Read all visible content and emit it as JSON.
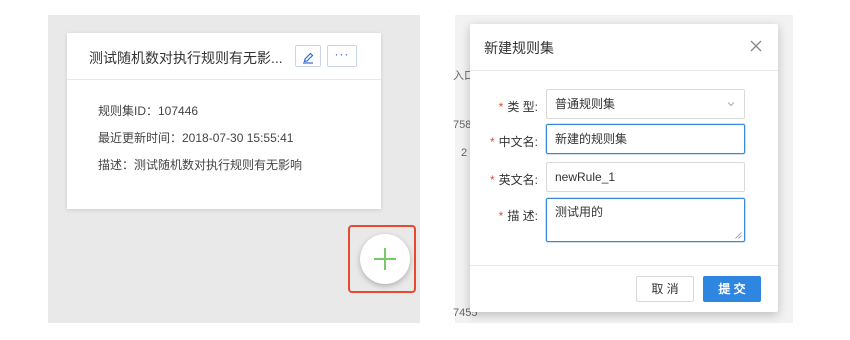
{
  "left": {
    "card": {
      "title": "测试随机数对执行规则有无影...",
      "more_label": "···",
      "fields": [
        {
          "text": "规则集ID：107446"
        },
        {
          "text": "最近更新时间：2018-07-30 15:55:41"
        },
        {
          "text": "描述：测试随机数对执行规则有无影响"
        }
      ]
    },
    "fab_color": "#7bc86c",
    "highlight_color": "#e84a2f"
  },
  "right": {
    "background_fragments": [
      "入口",
      "758",
      "2",
      "7455"
    ],
    "modal": {
      "title": "新建规则集",
      "fields": [
        {
          "label": "类  型:",
          "value": "普通规则集",
          "type": "select"
        },
        {
          "label": "中文名:",
          "value": "新建的规则集",
          "type": "input"
        },
        {
          "label": "英文名:",
          "value": "newRule_1",
          "type": "input"
        },
        {
          "label": "描  述:",
          "value": "测试用的",
          "type": "textarea"
        }
      ],
      "required_mark": "*",
      "cancel_label": "取 消",
      "submit_label": "提 交"
    },
    "accent_color": "#2f86e0"
  }
}
